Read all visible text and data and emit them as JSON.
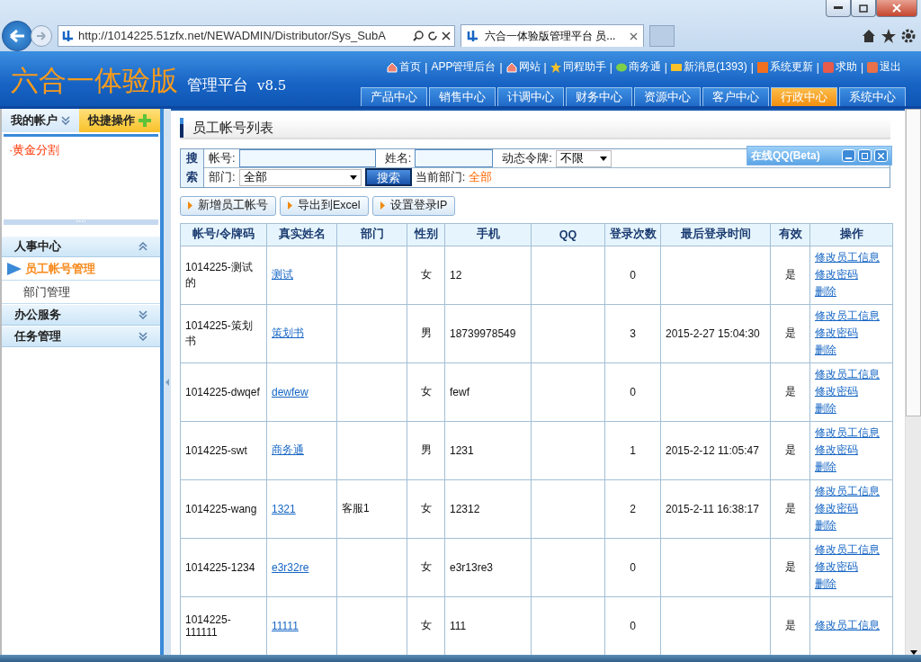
{
  "browser": {
    "url": "http://1014225.51zfx.net/NEWADMIN/Distributor/Sys_SubA",
    "tab_title": "六合一体验版管理平台 员..."
  },
  "header": {
    "logo": "六合一体验版",
    "subtitle": "管理平台",
    "version": "v8.5",
    "links": [
      {
        "label": "首页",
        "kind": "home"
      },
      {
        "separator": "|",
        "label": "APP管理后台",
        "kind": "plain"
      },
      {
        "separator": "|",
        "label": "网站",
        "kind": "home"
      },
      {
        "separator": "|",
        "label": "同程助手",
        "kind": "star"
      },
      {
        "separator": "|",
        "label": "商务通",
        "kind": "chat"
      },
      {
        "separator": "|",
        "label": "新消息(1393)",
        "kind": "mail"
      },
      {
        "separator": "|",
        "label": "系统更新",
        "kind": "n"
      },
      {
        "separator": "|",
        "label": "求助",
        "kind": "help"
      },
      {
        "separator": "|",
        "label": "退出",
        "kind": "exit"
      }
    ],
    "nav": [
      {
        "label": "产品中心",
        "selected": false
      },
      {
        "label": "销售中心",
        "selected": false
      },
      {
        "label": "计调中心",
        "selected": false
      },
      {
        "label": "财务中心",
        "selected": false
      },
      {
        "label": "资源中心",
        "selected": false
      },
      {
        "label": "客户中心",
        "selected": false
      },
      {
        "label": "行政中心",
        "selected": true
      },
      {
        "label": "系统中心",
        "selected": false
      }
    ]
  },
  "sidebar": {
    "account_tab": "我的帐户",
    "quick_tab": "快捷操作",
    "shortcuts": [
      "·黄金分割"
    ],
    "sections": [
      {
        "label": "人事中心",
        "expanded": true,
        "children": [
          {
            "label": "员工帐号管理",
            "selected": true
          },
          {
            "label": "部门管理",
            "selected": false
          }
        ]
      },
      {
        "label": "办公服务",
        "expanded": false
      },
      {
        "label": "任务管理",
        "expanded": false
      }
    ]
  },
  "content": {
    "title": "员工帐号列表",
    "search": {
      "label": "搜索",
      "account_label": "帐号:",
      "name_label": "姓名:",
      "token_label": "动态令牌:",
      "token_value": "不限",
      "dept_label": "部门:",
      "dept_value": "全部",
      "button": "搜索",
      "current_label": "当前部门:",
      "current_value": "全部"
    },
    "buttons": [
      "新增员工帐号",
      "导出到Excel",
      "设置登录IP"
    ],
    "table": {
      "columns": [
        "帐号/令牌码",
        "真实姓名",
        "部门",
        "性别",
        "手机",
        "QQ",
        "登录次数",
        "最后登录时间",
        "有效",
        "操作"
      ],
      "rows": [
        {
          "account": "1014225-测试的",
          "name": "测试",
          "dept": "",
          "gender": "女",
          "phone": "12",
          "qq": "",
          "count": "0",
          "last_login": "",
          "valid": "是",
          "ops": [
            "修改员工信息",
            "修改密码",
            "删除"
          ]
        },
        {
          "account": "1014225-策划书",
          "name": "策划书",
          "dept": "",
          "gender": "男",
          "phone": "18739978549",
          "qq": "",
          "count": "3",
          "last_login": "2015-2-27 15:04:30",
          "valid": "是",
          "ops": [
            "修改员工信息",
            "修改密码",
            "删除"
          ]
        },
        {
          "account": "1014225-dwqef",
          "name": "dewfew",
          "dept": "",
          "gender": "女",
          "phone": "fewf",
          "qq": "",
          "count": "0",
          "last_login": "",
          "valid": "是",
          "ops": [
            "修改员工信息",
            "修改密码",
            "删除"
          ]
        },
        {
          "account": "1014225-swt",
          "name": "商务通",
          "dept": "",
          "gender": "男",
          "phone": "1231",
          "qq": "",
          "count": "1",
          "last_login": "2015-2-12 11:05:47",
          "valid": "是",
          "ops": [
            "修改员工信息",
            "修改密码",
            "删除"
          ]
        },
        {
          "account": "1014225-wang",
          "name": "1321",
          "dept": "客服1",
          "gender": "女",
          "phone": "12312",
          "qq": "",
          "count": "2",
          "last_login": "2015-2-11 16:38:17",
          "valid": "是",
          "ops": [
            "修改员工信息",
            "修改密码",
            "删除"
          ]
        },
        {
          "account": "1014225-1234",
          "name": "e3r32re",
          "dept": "",
          "gender": "女",
          "phone": "e3r13re3",
          "qq": "",
          "count": "0",
          "last_login": "",
          "valid": "是",
          "ops": [
            "修改员工信息",
            "修改密码",
            "删除"
          ]
        },
        {
          "account": "1014225-111111",
          "name": "11111",
          "dept": "",
          "gender": "女",
          "phone": "111",
          "qq": "",
          "count": "0",
          "last_login": "",
          "valid": "是",
          "ops": [
            "修改员工信息"
          ]
        }
      ]
    }
  },
  "qq_window": {
    "title": "在线QQ(Beta)"
  }
}
